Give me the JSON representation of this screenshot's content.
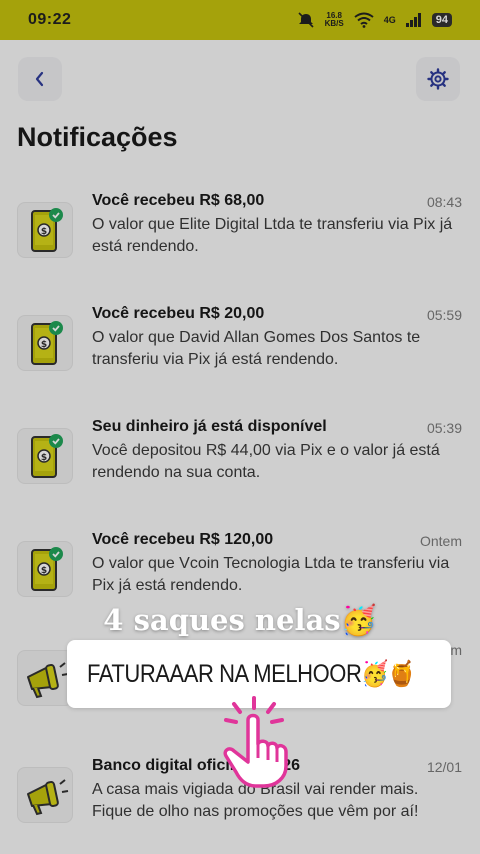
{
  "status_bar": {
    "time": "09:22",
    "speed_top": "16.8",
    "speed_bottom": "KB/S",
    "network": "4G",
    "battery": "94"
  },
  "header": {
    "title": "Notificações",
    "back_icon": "chevron-left-icon",
    "settings_icon": "gear-icon"
  },
  "notifications": [
    {
      "title": "Você recebeu R$ 68,00",
      "time": "08:43",
      "body": "O valor que Elite Digital Ltda te transferiu via Pix já está rendendo.",
      "icon": "phone-money-check-icon"
    },
    {
      "title": "Você recebeu R$ 20,00",
      "time": "05:59",
      "body": "O valor que David Allan Gomes Dos Santos te transferiu via Pix já está rendendo.",
      "icon": "phone-money-check-icon"
    },
    {
      "title": "Seu dinheiro já está disponível",
      "time": "05:39",
      "body": "Você depositou R$ 44,00 via Pix e o valor já está rendendo na sua conta.",
      "icon": "phone-money-check-icon"
    },
    {
      "title": "Você recebeu R$ 120,00",
      "time": "Ontem",
      "body": "O valor que Vcoin Tecnologia Ltda te transferiu via Pix já está rendendo.",
      "icon": "phone-money-check-icon"
    },
    {
      "title": "",
      "time": "m",
      "body": "",
      "icon": "megaphone-icon"
    },
    {
      "title": "Banco digital ofici... BBB26",
      "time": "12/01",
      "body": "A casa mais vigiada do Brasil vai render mais. Fique de olho nas promoções que vêm por aí!",
      "icon": "megaphone-icon"
    }
  ],
  "overlay": {
    "caption": "4 saques nelas🥳",
    "link_text": "FATURAAAR NA MELHOOR🥳🍯",
    "link_icon": "link-icon",
    "hand_icon": "tap-hand-icon"
  },
  "colors": {
    "brand_yellow": "#c5c20e",
    "check_green": "#22a45a",
    "accent_blue": "#2f3c9a",
    "link_gradient": [
      "#f04ea8",
      "#ff7a3c"
    ]
  }
}
